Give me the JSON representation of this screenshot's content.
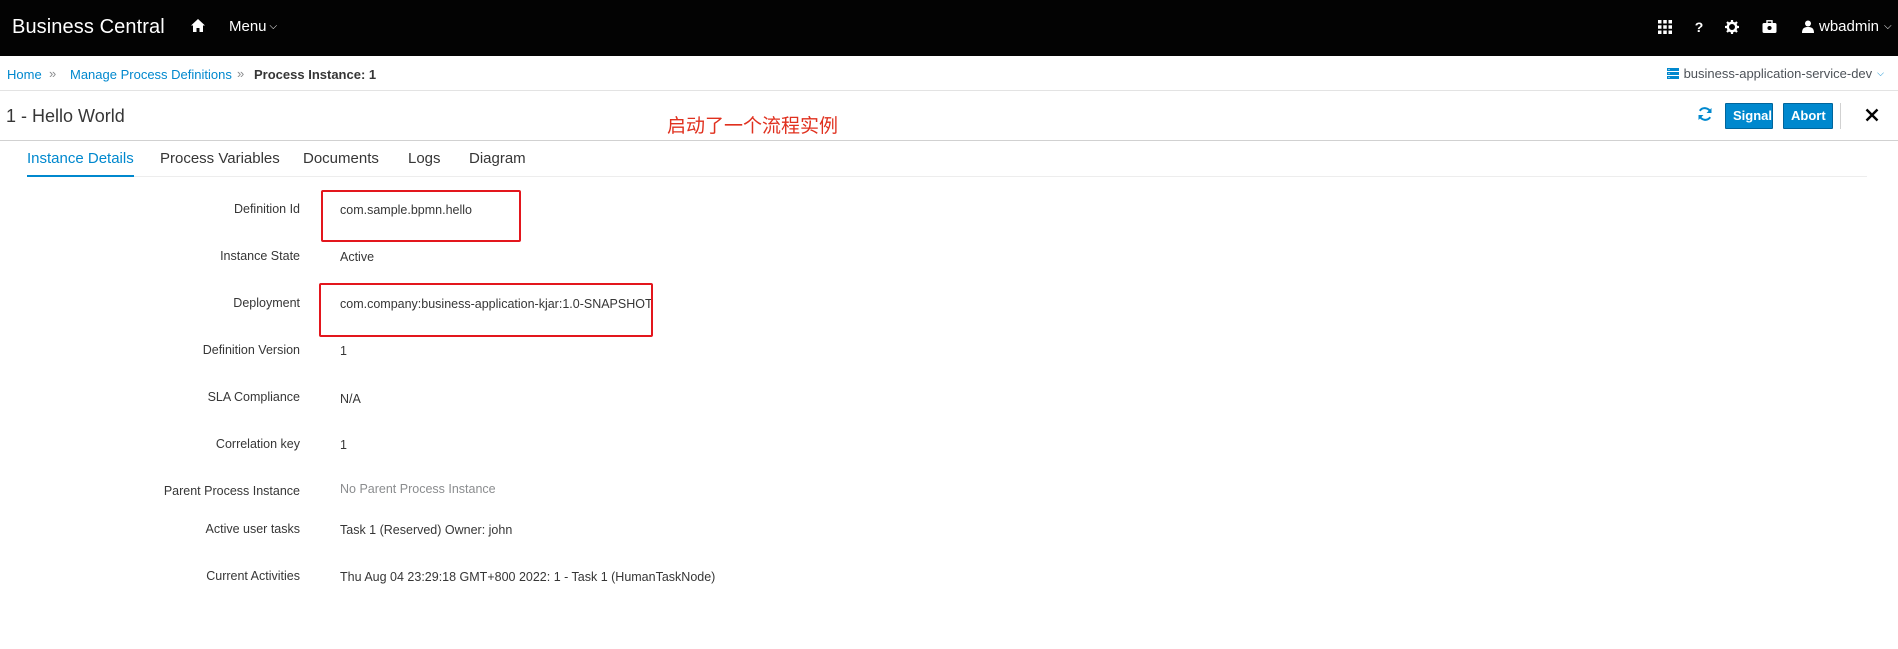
{
  "navbar": {
    "brand": "Business Central",
    "menu_label": "Menu",
    "user": "wbadmin"
  },
  "breadcrumb": {
    "home": "Home",
    "manage": "Manage Process Definitions",
    "current": "Process Instance: 1",
    "space": "business-application-service-dev"
  },
  "header": {
    "title": "1 - Hello World",
    "annotation": "启动了一个流程实例",
    "signal_label": "Signal",
    "abort_label": "Abort"
  },
  "tabs": [
    {
      "label": "Instance Details"
    },
    {
      "label": "Process Variables"
    },
    {
      "label": "Documents"
    },
    {
      "label": "Logs"
    },
    {
      "label": "Diagram"
    }
  ],
  "details": [
    {
      "label": "Definition Id",
      "value": "com.sample.bpmn.hello"
    },
    {
      "label": "Instance State",
      "value": "Active"
    },
    {
      "label": "Deployment",
      "value": "com.company:business-application-kjar:1.0-SNAPSHOT"
    },
    {
      "label": "Definition Version",
      "value": "1"
    },
    {
      "label": "SLA Compliance",
      "value": "N/A"
    },
    {
      "label": "Correlation key",
      "value": "1"
    },
    {
      "label": "Parent Process Instance",
      "value": "No Parent Process Instance"
    },
    {
      "label": "Active user tasks",
      "value": "Task 1 (Reserved) Owner: john"
    },
    {
      "label": "Current Activities",
      "value": "Thu Aug 04 23:29:18 GMT+800 2022: 1 - Task 1 (HumanTaskNode)"
    }
  ],
  "colors": {
    "accent": "#0088ce",
    "navbar": "#030303",
    "annotation": "#e0301e"
  }
}
